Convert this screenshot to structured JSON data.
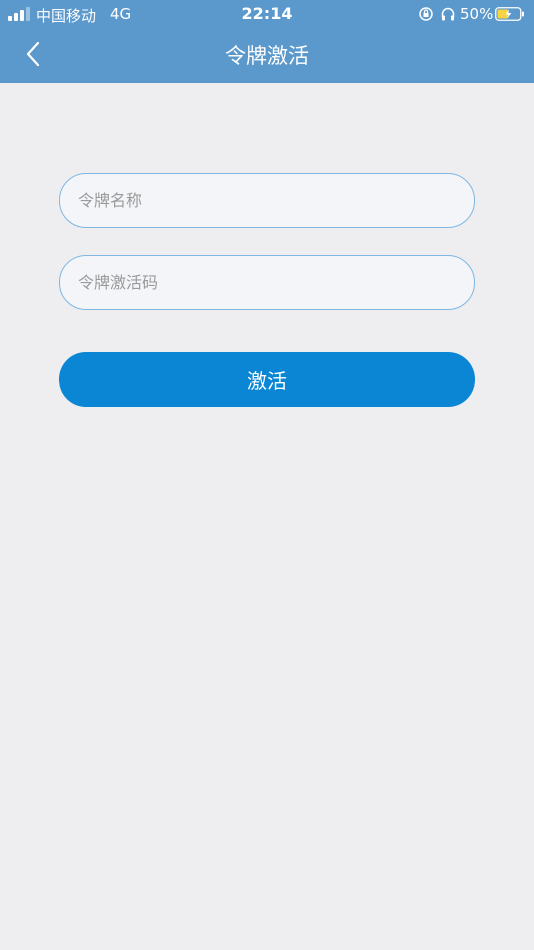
{
  "status_bar": {
    "carrier": "中国移动",
    "network": "4G",
    "time": "22:14",
    "battery_percent": "50%",
    "signal_bars": 3,
    "signal_bars_total": 4,
    "battery_level": 0.5,
    "icons": [
      "signal-icon",
      "orientation-lock-icon",
      "headphone-icon",
      "battery-charging-icon"
    ]
  },
  "nav": {
    "title": "令牌激活",
    "back_icon": "chevron-left-icon"
  },
  "form": {
    "token_name_placeholder": "令牌名称",
    "token_name_value": "",
    "activation_code_placeholder": "令牌激活码",
    "activation_code_value": "",
    "activate_label": "激活"
  },
  "colors": {
    "header_bg": "#5b99cc",
    "page_bg": "#eeeef1",
    "field_border": "#7db7e2",
    "field_bg": "#f3f5f9",
    "button_bg": "#0a86d4",
    "placeholder": "#9a9a9a"
  }
}
